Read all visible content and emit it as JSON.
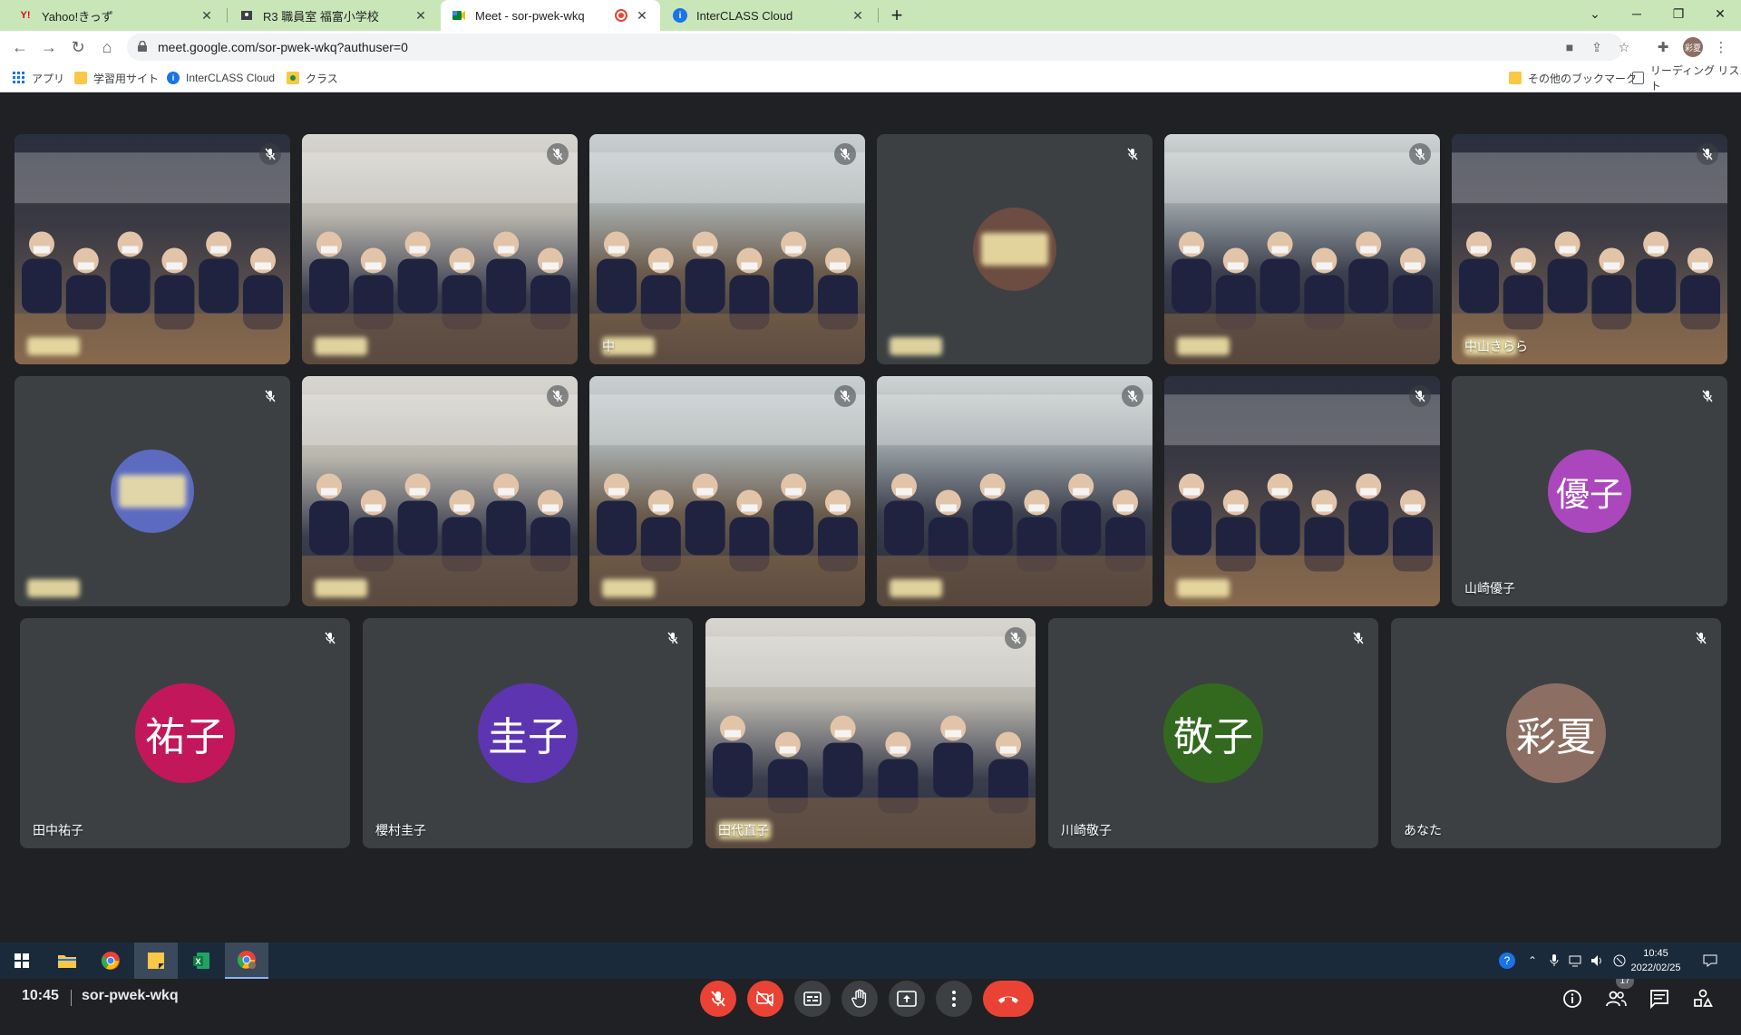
{
  "browser": {
    "tabs": [
      {
        "title": "Yahoo!きっず",
        "icon": "yahoo-kids-icon",
        "active": false
      },
      {
        "title": "R3 職員室 福富小学校",
        "icon": "classroom-icon",
        "active": false
      },
      {
        "title": "Meet - sor-pwek-wkq",
        "icon": "meet-icon",
        "active": true,
        "recording": true
      },
      {
        "title": "InterCLASS Cloud",
        "icon": "info-icon",
        "active": false
      }
    ],
    "url": "meet.google.com/sor-pwek-wkq?authuser=0",
    "profile_initials": "彩夏",
    "bookmarks": [
      {
        "label": "アプリ",
        "icon": "apps-grid-icon"
      },
      {
        "label": "学習用サイト",
        "icon": "folder-icon"
      },
      {
        "label": "InterCLASS Cloud",
        "icon": "info-icon"
      },
      {
        "label": "クラス",
        "icon": "classroom-icon"
      }
    ],
    "bookmarks_right": [
      {
        "label": "その他のブックマーク",
        "icon": "folder-icon"
      },
      {
        "label": "リーディング リスト",
        "icon": "reading-list-icon"
      }
    ]
  },
  "meet": {
    "participants": [
      {
        "name": "",
        "type": "video"
      },
      {
        "name": "",
        "type": "video"
      },
      {
        "name": "中",
        "type": "video"
      },
      {
        "name": "",
        "type": "avatar",
        "color": "#6d4c41"
      },
      {
        "name": "",
        "type": "video"
      },
      {
        "name": "中山きらら",
        "type": "video"
      },
      {
        "name": "",
        "type": "avatar",
        "color": "#5c6bc0"
      },
      {
        "name": "",
        "type": "video"
      },
      {
        "name": "",
        "type": "video"
      },
      {
        "name": "",
        "type": "video"
      },
      {
        "name": "",
        "type": "video"
      },
      {
        "name": "山崎優子",
        "type": "avatar",
        "initials": "優子",
        "color": "#ab47bc"
      },
      {
        "name": "田中祐子",
        "type": "avatar",
        "initials": "祐子",
        "color": "#c2185b"
      },
      {
        "name": "櫻村圭子",
        "type": "avatar",
        "initials": "圭子",
        "color": "#5e35b1"
      },
      {
        "name": "田代直子",
        "type": "video"
      },
      {
        "name": "川崎敬子",
        "type": "avatar",
        "initials": "敬子",
        "color": "#33691e"
      },
      {
        "name": "あなた",
        "type": "avatar",
        "initials": "彩夏",
        "color": "#8d6e63"
      }
    ],
    "time": "10:45",
    "meeting_code": "sor-pwek-wkq",
    "people_count": "17",
    "accent_red": "#ea4335"
  },
  "taskbar": {
    "clock_time": "10:45",
    "clock_date": "2022/02/25",
    "apps": [
      "start-icon",
      "file-explorer-icon",
      "chrome-icon",
      "sticky-notes-icon",
      "excel-icon",
      "chrome-profile-icon"
    ]
  }
}
